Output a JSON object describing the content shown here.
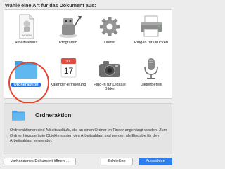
{
  "dialog": {
    "heading": "Wähle eine Art für das Dokument aus:"
  },
  "types": [
    {
      "label": "Arbeitsablauf",
      "icon": "workflow-document-icon",
      "icon_text": "WFLOW"
    },
    {
      "label": "Programm",
      "icon": "automator-robot-icon"
    },
    {
      "label": "Dienst",
      "icon": "gear-icon"
    },
    {
      "label": "Plug-in für Drucken",
      "icon": "printer-icon"
    },
    {
      "label": "Ordneraktion",
      "icon": "folder-icon",
      "selected": true
    },
    {
      "label": "Kalender-erinnerung",
      "icon": "calendar-icon",
      "icon_month": "JUL",
      "icon_day": "17"
    },
    {
      "label": "Plug-in für Digitale Bilder",
      "icon": "camera-icon"
    },
    {
      "label": "Diktierbefehl",
      "icon": "microphone-icon"
    }
  ],
  "description": {
    "title": "Ordneraktion",
    "text": "Ordneraktionen sind Arbeitsabläufe, die an einen Ordner im Finder angehängt werden. Zum Ordner hinzugefügte Objekte starten den Arbeitsablauf und werden als Eingabe für den Arbeitsablauf verwendet."
  },
  "buttons": {
    "open_existing": "Vorhandenes Dokument öffnen ...",
    "close": "Schließen",
    "choose": "Auswählen"
  },
  "colors": {
    "accent": "#2a7ef0",
    "selection_ring": "#e5472c",
    "folder": "#5fb8ef"
  }
}
